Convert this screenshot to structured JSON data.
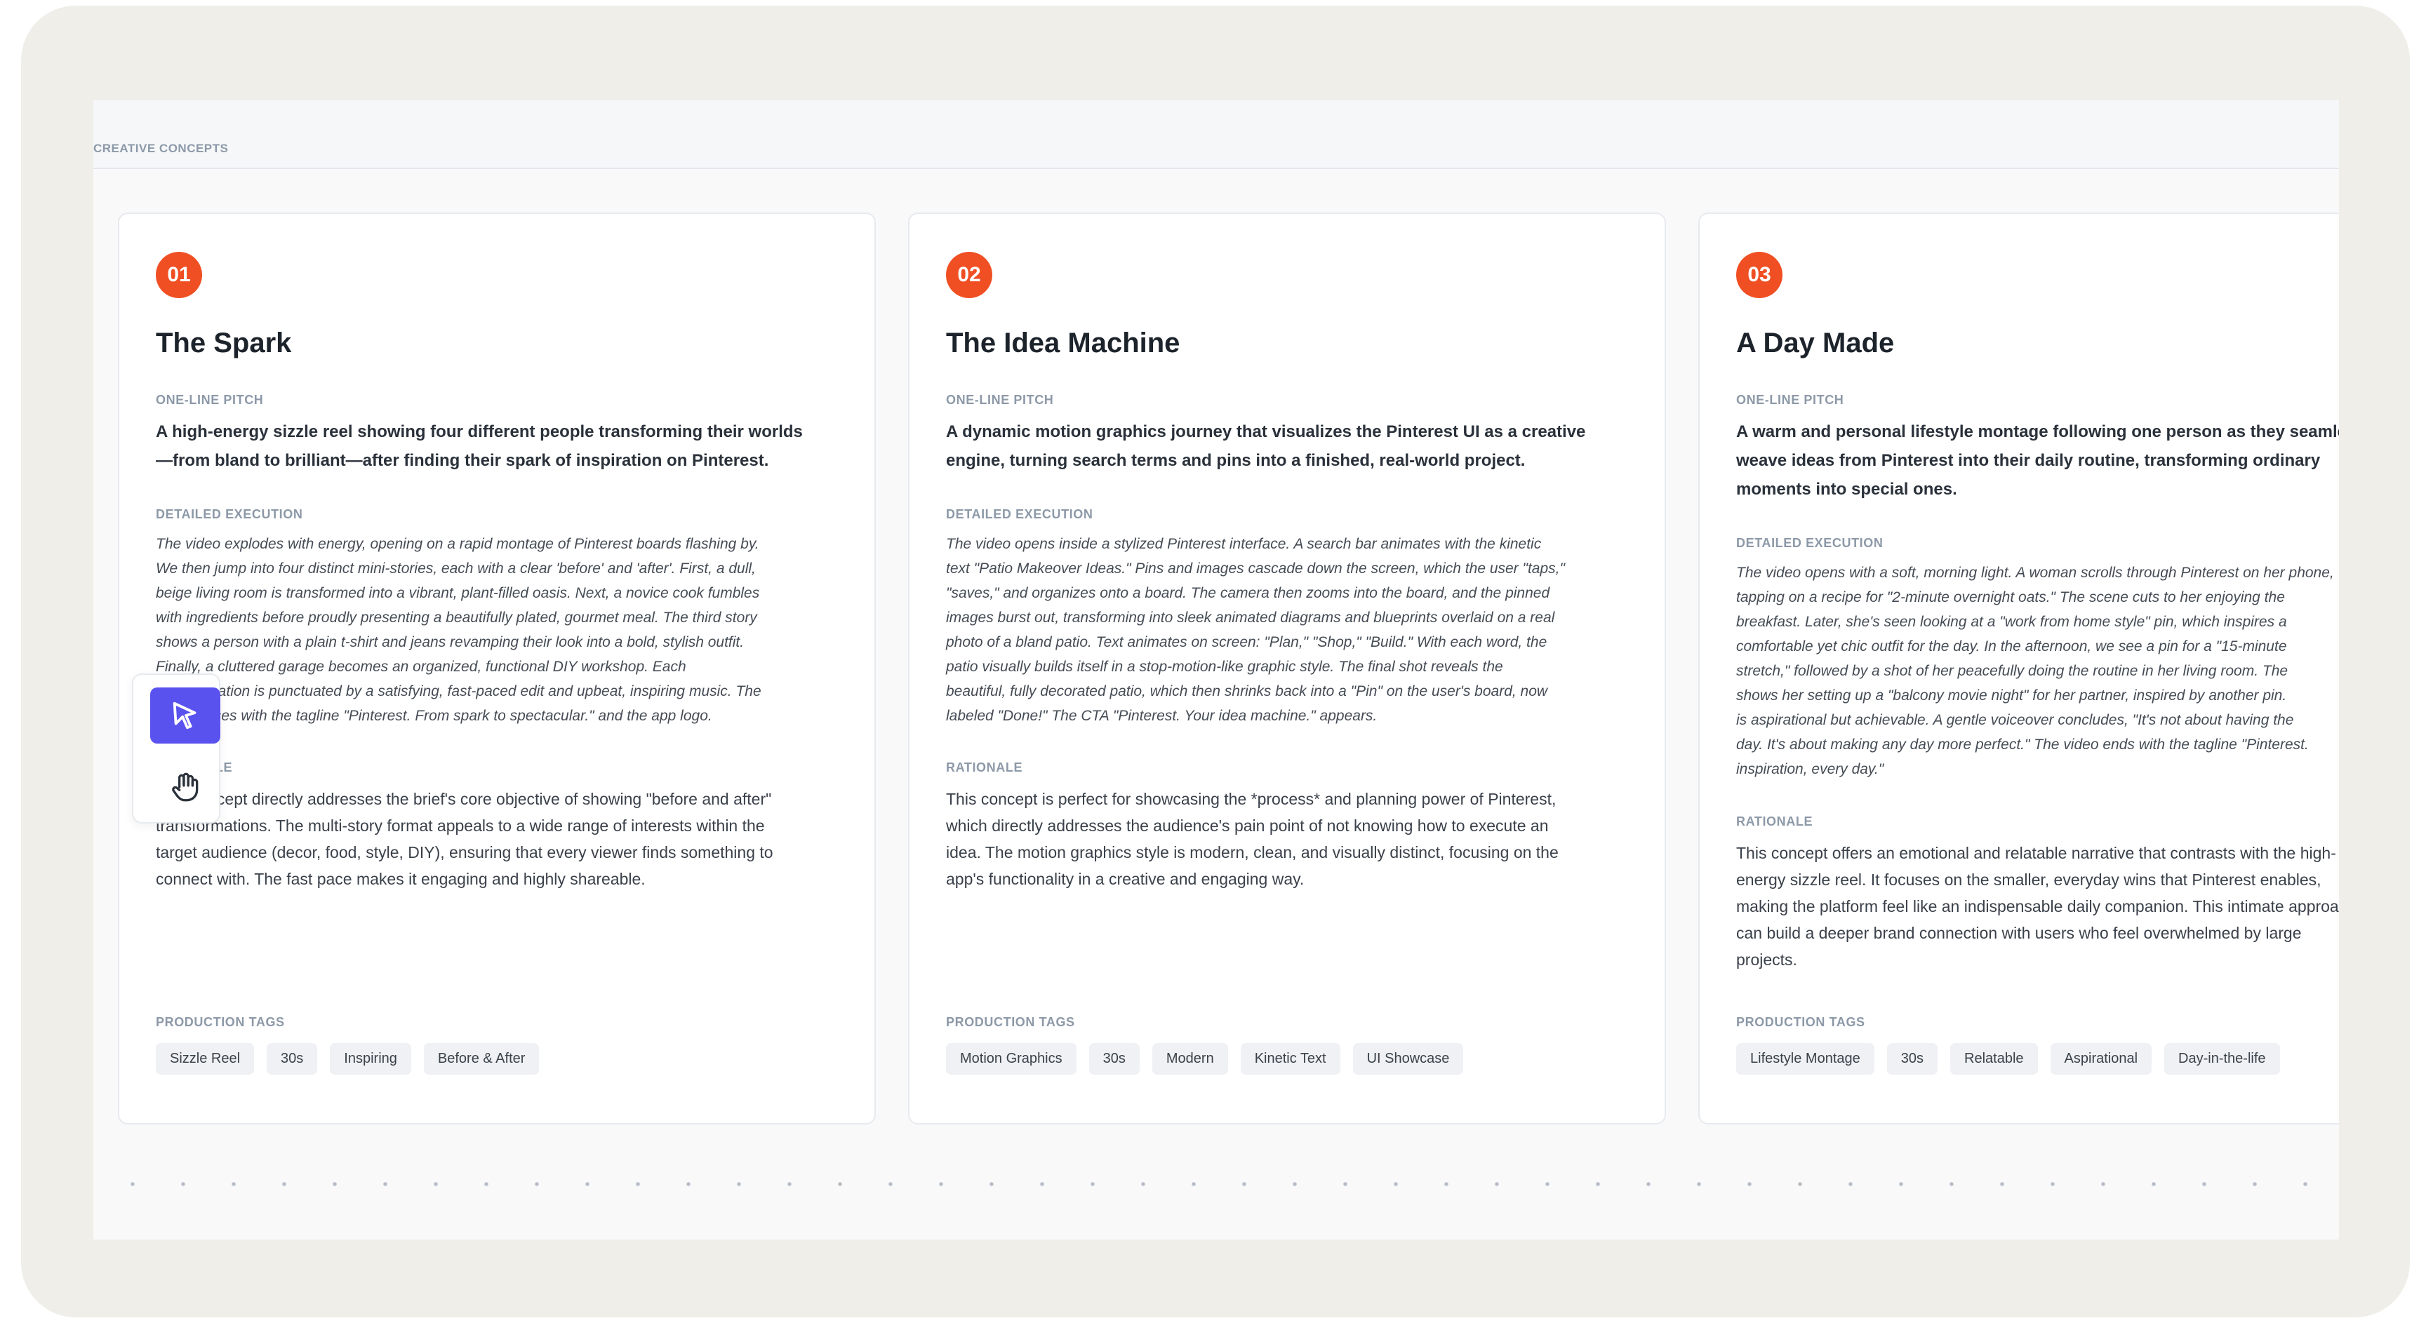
{
  "section": {
    "label": "CREATIVE CONCEPTS"
  },
  "labels": {
    "pitch": "ONE-LINE PITCH",
    "execution": "DETAILED EXECUTION",
    "rationale": "RATIONALE",
    "tags": "PRODUCTION TAGS"
  },
  "cards": [
    {
      "number": "01",
      "title": "The Spark",
      "pitch_lines": [
        "A high-energy sizzle reel showing four different people transforming their worlds",
        "—from bland to brilliant—after finding their spark of inspiration on Pinterest."
      ],
      "execution_lines": [
        "The video explodes with energy, opening on a rapid montage of Pinterest boards flashing by.",
        "We then jump into four distinct mini-stories, each with a clear 'before' and 'after'. First, a dull,",
        "beige living room is transformed into a vibrant, plant-filled oasis. Next, a novice cook fumbles",
        "with ingredients before proudly presenting a beautifully plated, gourmet meal. The third story",
        "shows a person with a plain t-shirt and jeans revamping their look into a bold, stylish outfit.",
        "Finally, a cluttered garage becomes an organized, functional DIY workshop. Each",
        "transformation is punctuated by a satisfying, fast-paced edit and upbeat, inspiring music. The",
        "video closes with the tagline \"Pinterest. From spark to spectacular.\" and the app logo."
      ],
      "rationale_lines": [
        "This concept directly addresses the brief's core objective of showing \"before and after\"",
        "transformations. The multi-story format appeals to a wide range of interests within the",
        "target audience (decor, food, style, DIY), ensuring that every viewer finds something to",
        "connect with. The fast pace makes it engaging and highly shareable."
      ],
      "tags": [
        "Sizzle Reel",
        "30s",
        "Inspiring",
        "Before & After"
      ]
    },
    {
      "number": "02",
      "title": "The Idea Machine",
      "pitch_lines": [
        "A dynamic motion graphics journey that visualizes the Pinterest UI as a creative",
        "engine, turning search terms and pins into a finished, real-world project."
      ],
      "execution_lines": [
        "The video opens inside a stylized Pinterest interface. A search bar animates with the kinetic",
        "text \"Patio Makeover Ideas.\" Pins and images cascade down the screen, which the user \"taps,\"",
        "\"saves,\" and organizes onto a board. The camera then zooms into the board, and the pinned",
        "images burst out, transforming into sleek animated diagrams and blueprints overlaid on a real",
        "photo of a bland patio. Text animates on screen: \"Plan,\" \"Shop,\" \"Build.\" With each word, the",
        "patio visually builds itself in a stop-motion-like graphic style. The final shot reveals the",
        "beautiful, fully decorated patio, which then shrinks back into a \"Pin\" on the user's board, now",
        "labeled \"Done!\" The CTA \"Pinterest. Your idea machine.\" appears."
      ],
      "rationale_lines": [
        "This concept is perfect for showcasing the *process* and planning power of Pinterest,",
        "which directly addresses the audience's pain point of not knowing how to execute an",
        "idea. The motion graphics style is modern, clean, and visually distinct, focusing on the",
        "app's functionality in a creative and engaging way."
      ],
      "tags": [
        "Motion Graphics",
        "30s",
        "Modern",
        "Kinetic Text",
        "UI Showcase"
      ]
    },
    {
      "number": "03",
      "title": "A Day Made",
      "pitch_lines": [
        "A warm and personal lifestyle montage following one person as they seamlessly",
        "weave ideas from Pinterest into their daily routine, transforming ordinary",
        "moments into special ones."
      ],
      "execution_lines": [
        "The video opens with a soft, morning light. A woman scrolls through Pinterest on her phone,",
        "tapping on a recipe for \"2-minute overnight oats.\" The scene cuts to her enjoying the",
        "breakfast. Later, she's seen looking at a \"work from home style\" pin, which inspires a",
        "comfortable yet chic outfit for the day. In the afternoon, we see a pin for a \"15-minute",
        "stretch,\" followed by a shot of her peacefully doing the routine in her living room. The",
        "shows her setting up a \"balcony movie night\" for her partner, inspired by another pin.",
        "is aspirational but achievable. A gentle voiceover concludes, \"It's not about having the",
        "day. It's about making any day more perfect.\" The video ends with the tagline \"Pinterest.",
        "inspiration, every day.\""
      ],
      "rationale_lines": [
        "This concept offers an emotional and relatable narrative that contrasts with the high-",
        "energy sizzle reel. It focuses on the smaller, everyday wins that Pinterest enables,",
        "making the platform feel like an indispensable daily companion. This intimate approach",
        "can build a deeper brand connection with users who feel overwhelmed by large",
        "projects."
      ],
      "tags": [
        "Lifestyle Montage",
        "30s",
        "Relatable",
        "Aspirational",
        "Day-in-the-life"
      ]
    }
  ],
  "toolbar": {
    "tools": [
      {
        "icon": "cursor-arrow-icon",
        "active": true
      },
      {
        "icon": "hand-pan-icon",
        "active": false
      }
    ]
  },
  "colors": {
    "accent": "#f04f23",
    "tool_active": "#5a52ee",
    "frame": "#efeee9"
  }
}
